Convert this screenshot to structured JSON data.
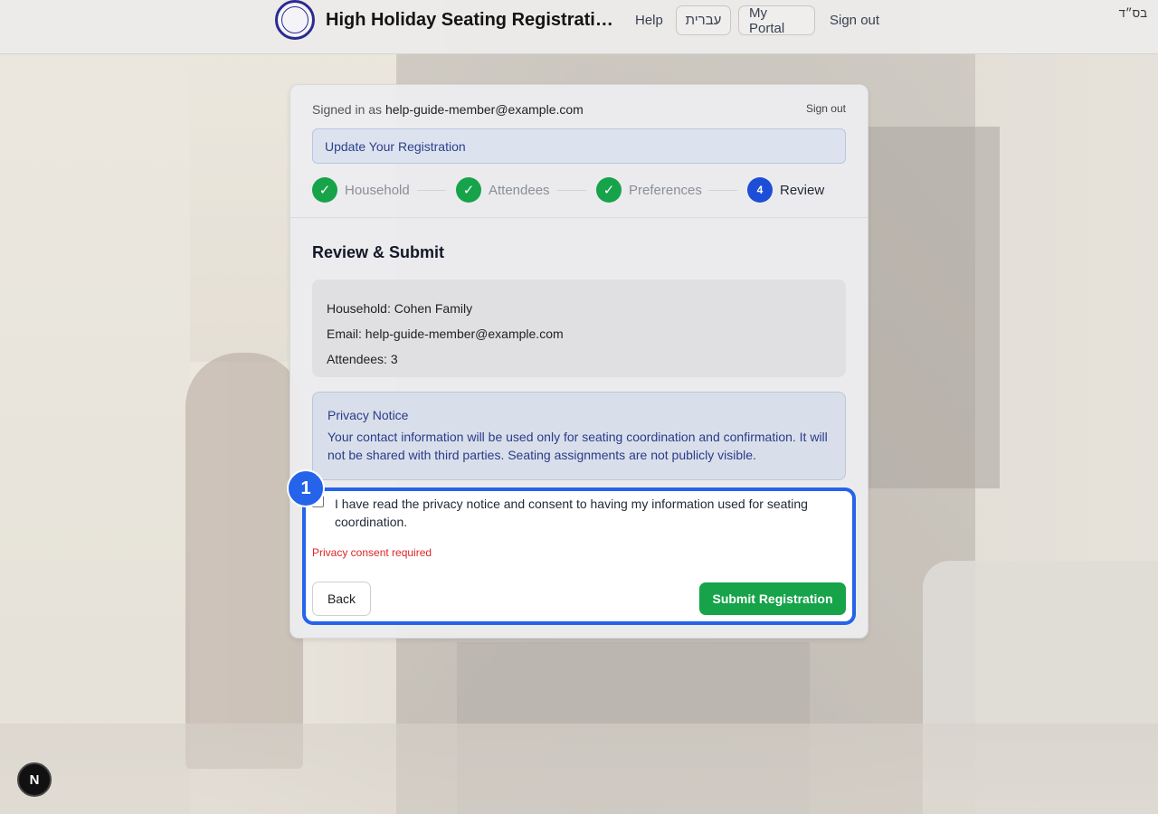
{
  "header": {
    "title": "High Holiday Seating Registrati…",
    "help": "Help",
    "hebrew": "עברית",
    "portal": "My Portal",
    "signout": "Sign out",
    "bsd": "בס״ד"
  },
  "card": {
    "signed_prefix": "Signed in as",
    "signed_email": "help-guide-member@example.com",
    "signout": "Sign out",
    "banner": "Update Your Registration",
    "steps": [
      {
        "label": "Household",
        "icon": "check-icon",
        "mark": "✓",
        "state": "done"
      },
      {
        "label": "Attendees",
        "icon": "check-icon",
        "mark": "✓",
        "state": "done"
      },
      {
        "label": "Preferences",
        "icon": "check-icon",
        "mark": "✓",
        "state": "done"
      },
      {
        "label": "Review",
        "mark": "4",
        "state": "active"
      }
    ],
    "review_title": "Review & Submit",
    "summary": {
      "household": "Household: Cohen Family",
      "email": "Email: help-guide-member@example.com",
      "attendees": "Attendees: 3"
    },
    "privacy": {
      "title": "Privacy Notice",
      "body": "Your contact information will be used only for seating coordination and confirmation. It will not be shared with third parties. Seating assignments are not publicly visible."
    },
    "consent": {
      "text": "I have read the privacy notice and consent to having my information used for seating coordination.",
      "checked": false,
      "error": "Privacy consent required"
    },
    "back": "Back",
    "submit": "Submit Registration"
  },
  "annotation": {
    "badge": "1"
  },
  "dev_badge": "N",
  "colors": {
    "accent": "#2563eb",
    "success": "#16a34a",
    "error": "#dc2626"
  }
}
